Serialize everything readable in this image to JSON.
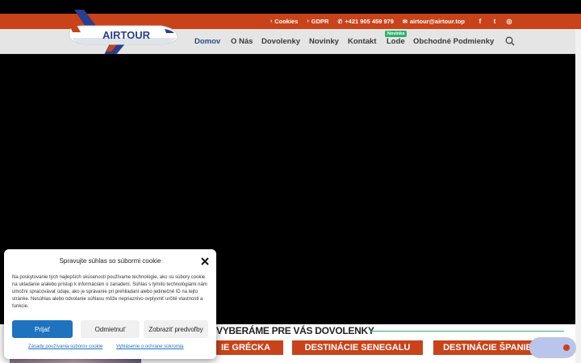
{
  "topbar": {
    "links": [
      {
        "icon": "chevron-right-icon",
        "glyph": "›",
        "label": "Cookies"
      },
      {
        "icon": "chevron-right-icon",
        "glyph": "›",
        "label": "GDPR"
      },
      {
        "icon": "phone-icon",
        "glyph": "✆",
        "label": "+421 905 459 979"
      },
      {
        "icon": "mail-icon",
        "glyph": "✉",
        "label": "airtour@airtour.top"
      }
    ],
    "social": [
      {
        "icon": "facebook-icon",
        "glyph": "f"
      },
      {
        "icon": "twitter-icon",
        "glyph": "t"
      },
      {
        "icon": "instagram-icon",
        "glyph": "◎"
      }
    ]
  },
  "logo": {
    "text": "AIRTOUR"
  },
  "nav": {
    "items": [
      "Domov",
      "O Nás",
      "Dovolenky",
      "Novinky",
      "Kontakt",
      "Lode",
      "Obchodné Podmienky"
    ],
    "badge": "Novinka"
  },
  "section": {
    "title": "VYBERÁME PRE VÁS DOVOLENKY",
    "destinations": [
      "IE GRÉCKA",
      "DESTINÁCIE SENEGALU",
      "DESTINÁCIE ŠPANIELSKA"
    ]
  },
  "cookie": {
    "title": "Spravujte súhlas so súbormi cookie",
    "text": "Na poskytovanie tých najlepších skúseností používame technológie, ako sú súbory cookie na ukladanie a/alebo prístup k informáciám o zariadení. Súhlas s týmito technológiami nám umožní spracovávať údaje, ako je správanie pri prehliadaní alebo jedinečné ID na tejto stránke. Nesúhlas alebo odvolanie súhlasu môže nepriaznivo ovplyvniť určité vlastnosti a funkcie.",
    "accept": "Prijať",
    "deny": "Odmietnuť",
    "preferences": "Zobraziť predvoľby",
    "policy_link": "Zásady používania súborov cookie",
    "privacy_link": "Vyhlásenie o ochrane súkromia"
  },
  "colors": {
    "brand": "#c8431a",
    "nav_active": "#2a4a8c",
    "accept": "#1e73be",
    "badge": "#2bb56d"
  }
}
